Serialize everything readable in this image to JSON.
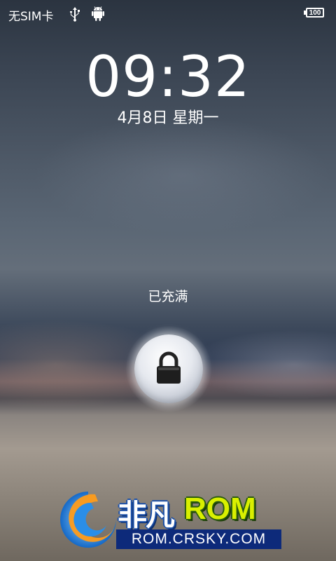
{
  "status_bar": {
    "sim_status": "无SIM卡",
    "usb_icon": "usb-icon",
    "debug_icon": "android-debug-icon",
    "battery_level": "100"
  },
  "lockscreen": {
    "time": "09:32",
    "date": "4月8日 星期一",
    "charging_status": "已充满",
    "lock_icon": "padlock-icon"
  },
  "watermark": {
    "brand_cn": "非凡",
    "brand_en": "ROM",
    "url": "ROM.CRSKY.COM"
  }
}
